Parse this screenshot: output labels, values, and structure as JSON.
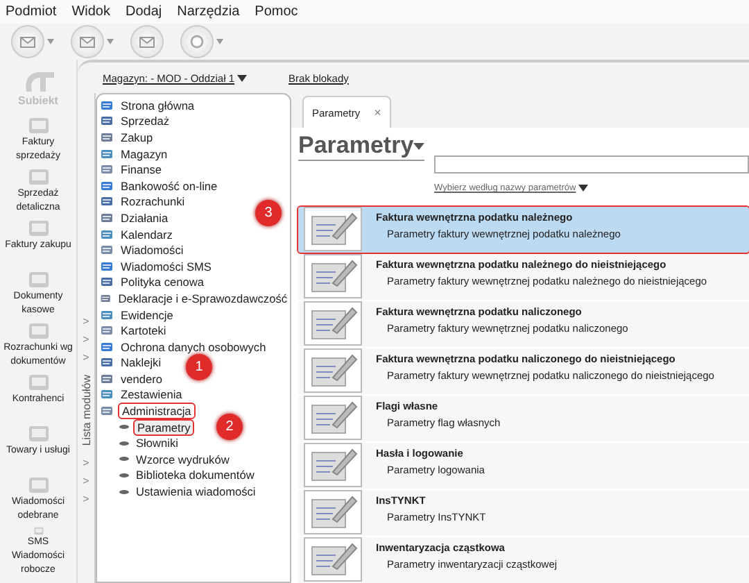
{
  "menu": [
    "Podmiot",
    "Widok",
    "Dodaj",
    "Narzędzia",
    "Pomoc"
  ],
  "logo": {
    "label": "Subiekt"
  },
  "sidebar": {
    "items": [
      {
        "label": "Faktury sprzedaży"
      },
      {
        "label": "Sprzedaż detaliczna"
      },
      {
        "label": "Faktury zakupu"
      },
      {
        "label": "Dokumenty kasowe"
      },
      {
        "label": "Rozrachunki wg dokumentów"
      },
      {
        "label": "Kontrahenci"
      },
      {
        "label": "Towary i usługi"
      },
      {
        "label": "Wiadomości odebrane"
      },
      {
        "label": "SMS Wiadomości robocze"
      }
    ]
  },
  "module_strip": {
    "label": "Lista modułów",
    "chevrons_top": [
      ">",
      ">",
      ">"
    ],
    "chevrons_bottom": [
      ">",
      ">",
      ">"
    ]
  },
  "header": {
    "warehouse": "Magazyn: - MOD - Oddział 1",
    "lock": "Brak blokady"
  },
  "tree": [
    {
      "label": "Strona główna",
      "selected": false
    },
    {
      "label": "Sprzedaż",
      "selected": false
    },
    {
      "label": "Zakup",
      "selected": false
    },
    {
      "label": "Magazyn",
      "selected": false
    },
    {
      "label": "Finanse",
      "selected": false
    },
    {
      "label": "Bankowość on-line",
      "selected": false
    },
    {
      "label": "Rozrachunki",
      "selected": false
    },
    {
      "label": "Działania",
      "selected": false
    },
    {
      "label": "Kalendarz",
      "selected": false
    },
    {
      "label": "Wiadomości",
      "selected": false
    },
    {
      "label": "Wiadomości SMS",
      "selected": false
    },
    {
      "label": "Polityka cenowa",
      "selected": false
    },
    {
      "label": "Deklaracje i e-Sprawozdawczość",
      "selected": false
    },
    {
      "label": "Ewidencje",
      "selected": false
    },
    {
      "label": "Kartoteki",
      "selected": false
    },
    {
      "label": "Ochrona danych osobowych",
      "selected": false
    },
    {
      "label": "Naklejki",
      "selected": false
    },
    {
      "label": "vendero",
      "selected": false
    },
    {
      "label": "Zestawienia",
      "selected": false
    },
    {
      "label": "Administracja",
      "selected": false,
      "expanded": true,
      "children": [
        {
          "label": "Parametry",
          "selected": true
        },
        {
          "label": "Słowniki",
          "selected": false
        },
        {
          "label": "Wzorce wydruków",
          "selected": false
        },
        {
          "label": "Biblioteka dokumentów",
          "selected": false
        },
        {
          "label": "Ustawienia wiadomości",
          "selected": false
        }
      ]
    }
  ],
  "tab": {
    "label": "Parametry",
    "close": "×"
  },
  "title": "Parametry",
  "filter": "Wybierz według nazwy parametrów",
  "parameters": [
    {
      "title": "Faktura wewnętrzna podatku należnego",
      "description": "Parametry faktury wewnętrznej podatku należnego",
      "selected": true
    },
    {
      "title": "Faktura wewnętrzna podatku należnego do nieistniejącego",
      "description": "Parametry faktury wewnętrznej podatku należnego do nieistniejącego",
      "selected": false
    },
    {
      "title": "Faktura wewnętrzna podatku naliczonego",
      "description": "Parametry faktury wewnętrznej podatku naliczonego",
      "selected": false
    },
    {
      "title": "Faktura wewnętrzna podatku naliczonego do nieistniejącego",
      "description": "Parametry faktury wewnętrznej podatku naliczonego do nieistniejącego",
      "selected": false
    },
    {
      "title": "Flagi własne",
      "description": "Parametry flag własnych",
      "selected": false
    },
    {
      "title": "Hasła i logowanie",
      "description": "Parametry logowania",
      "selected": false
    },
    {
      "title": "InsTYNKT",
      "description": "Parametry InsTYNKT",
      "selected": false
    },
    {
      "title": "Inwentaryzacja cząstkowa",
      "description": "Parametry inwentaryzacji cząstkowej",
      "selected": false
    }
  ],
  "annotations": [
    "1",
    "2",
    "3"
  ]
}
